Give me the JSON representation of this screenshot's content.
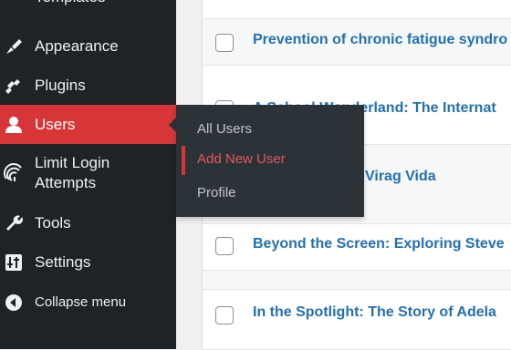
{
  "sidebar": {
    "items": [
      {
        "label": "Templates",
        "icon": "templates-icon"
      },
      {
        "label": "Appearance",
        "icon": "paintbrush-icon"
      },
      {
        "label": "Plugins",
        "icon": "plug-icon"
      },
      {
        "label": "Users",
        "icon": "user-icon",
        "active": true
      },
      {
        "label": "Limit Login Attempts",
        "label_lines": [
          "Limit Login",
          "Attempts"
        ],
        "icon": "fingerprint-icon"
      },
      {
        "label": "Tools",
        "icon": "wrench-icon"
      },
      {
        "label": "Settings",
        "icon": "sliders-icon"
      },
      {
        "label": "Collapse menu",
        "icon": "collapse-icon"
      }
    ]
  },
  "users_submenu": {
    "items": [
      {
        "label": "All Users"
      },
      {
        "label": "Add New User",
        "current": true
      },
      {
        "label": "Profile"
      }
    ]
  },
  "posts": {
    "rows": [
      {
        "title": "Prevention of chronic fatigue syndro"
      },
      {
        "title": "A School Wonderland: The Internat",
        "partially_hidden": true
      },
      {
        "title": "Virag Vida",
        "partially_hidden": true
      },
      {
        "title": "Beyond the Screen: Exploring Steve"
      },
      {
        "title": "In the Spotlight: The Story of Adela"
      }
    ]
  },
  "colors": {
    "sidebar_bg": "#1d2327",
    "active_bg": "#d63638",
    "flyout_bg": "#2c3338",
    "link": "#2271b1"
  }
}
